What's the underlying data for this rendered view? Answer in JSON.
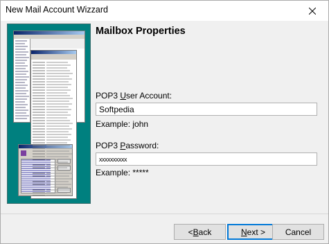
{
  "window": {
    "title": "New Mail Account Wizzard"
  },
  "page": {
    "heading": "Mailbox Properties"
  },
  "account_field": {
    "label_before": "POP3 ",
    "label_mnemonic": "U",
    "label_after": "ser Account:",
    "value": "Softpedia",
    "example": "Example: john"
  },
  "password_field": {
    "label_before": "POP3 ",
    "label_mnemonic": "P",
    "label_after": "assword:",
    "value": "xxxxxxxxxx",
    "example": "Example: *****"
  },
  "buttons": {
    "back_prefix": "< ",
    "back_mnemonic": "B",
    "back_rest": "ack",
    "next_mnemonic": "N",
    "next_rest": "ext >",
    "cancel": "Cancel"
  },
  "icons": {
    "close": "close-icon",
    "illustration": "email-client-screenshot-illustration"
  }
}
